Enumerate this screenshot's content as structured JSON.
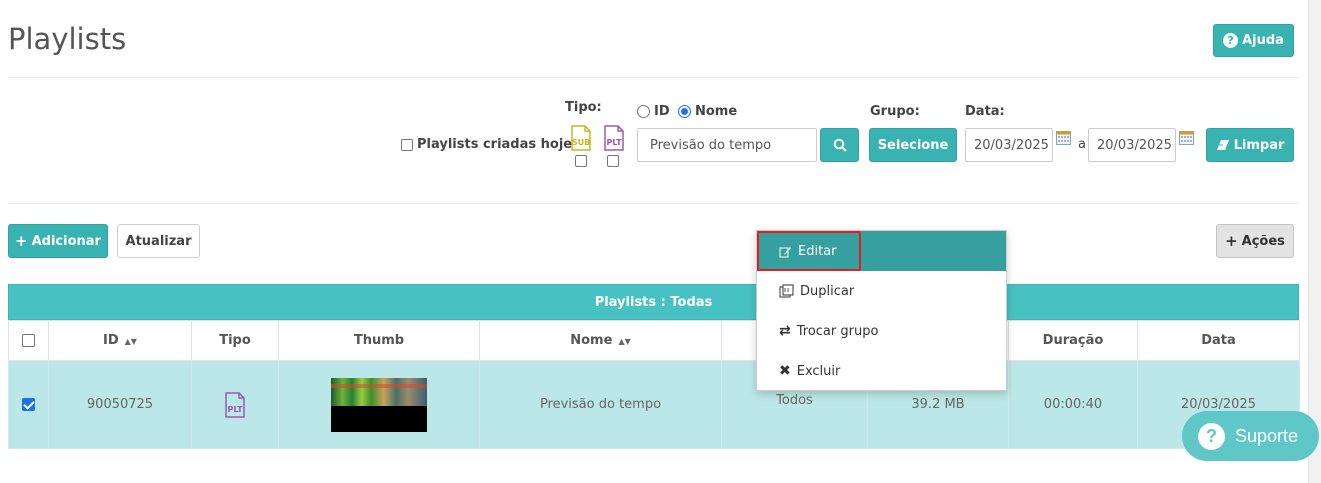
{
  "page": {
    "title": "Playlists",
    "help_label": "Ajuda"
  },
  "filters": {
    "today_label": "Playlists criadas hoje",
    "tipo_label": "Tipo:",
    "tipo_options": [
      {
        "text": "SUB",
        "icon": "sub-file-icon",
        "color": "#c8b51f"
      },
      {
        "text": "PLT",
        "icon": "plt-file-icon",
        "color": "#9b59b6"
      }
    ],
    "search_by_options": [
      "ID",
      "Nome"
    ],
    "search_by_selected": "Nome",
    "search_value": "Previsão do tempo",
    "grupo_label": "Grupo:",
    "grupo_button": "Selecione",
    "data_label": "Data:",
    "date_from": "20/03/2025",
    "date_separator": "a",
    "date_to": "20/03/2025",
    "clear_label": "Limpar"
  },
  "toolbar": {
    "add_label": "Adicionar",
    "refresh_label": "Atualizar",
    "actions_label": "Ações"
  },
  "table": {
    "title": "Playlists : Todas",
    "headers": [
      "ID",
      "Tipo",
      "Thumb",
      "Nome",
      "",
      "",
      "Duração",
      "Data"
    ],
    "rows": [
      {
        "checked": true,
        "id": "90050725",
        "tipo": "PLT",
        "nome": "Previsão do tempo",
        "grupo": "Todos",
        "tamanho": "39.2 MB",
        "duracao": "00:00:40",
        "data": "20/03/2025"
      }
    ]
  },
  "context_menu": {
    "items": [
      {
        "label": "Editar",
        "icon": "edit-icon"
      },
      {
        "label": "Duplicar",
        "icon": "duplicate-icon"
      },
      {
        "label": "Trocar grupo",
        "icon": "swap-icon"
      },
      {
        "label": "Excluir",
        "icon": "close-icon"
      }
    ],
    "active_index": 0
  },
  "support": {
    "label": "Suporte"
  },
  "colors": {
    "accent": "#39b3b2",
    "table_header": "#48c1c3",
    "row_selected": "#bce7e8",
    "menu_active": "#36a0a1",
    "highlight": "#e02020"
  }
}
